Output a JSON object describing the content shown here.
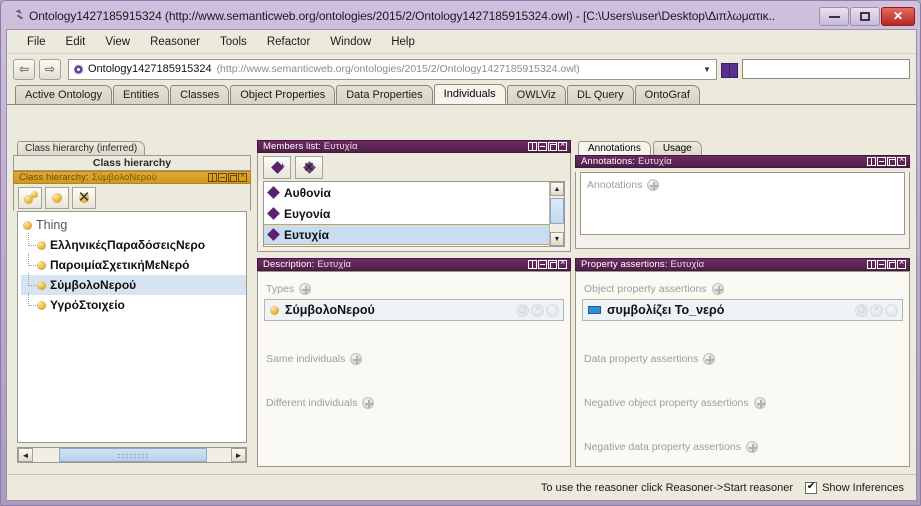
{
  "window": {
    "title": "Ontology1427185915324 (http://www.semanticweb.org/ontologies/2015/2/Ontology1427185915324.owl) - [C:\\Users\\user\\Desktop\\Διπλωματικ..",
    "icon": "protege-icon",
    "buttons": {
      "minimize": "",
      "maximize": "",
      "close": "✕"
    }
  },
  "menubar": {
    "items": [
      "File",
      "Edit",
      "View",
      "Reasoner",
      "Tools",
      "Refactor",
      "Window",
      "Help"
    ]
  },
  "toolbar": {
    "back_label": "⇦",
    "forward_label": "⇨",
    "ontology_name": "Ontology1427185915324",
    "ontology_iri": "(http://www.semanticweb.org/ontologies/2015/2/Ontology1427185915324.owl)",
    "combo_arrow": "▼",
    "search_placeholder": "",
    "search_value": ""
  },
  "tabs": {
    "items": [
      {
        "label": "Active Ontology",
        "active": false
      },
      {
        "label": "Entities",
        "active": false
      },
      {
        "label": "Classes",
        "active": false
      },
      {
        "label": "Object Properties",
        "active": false
      },
      {
        "label": "Data Properties",
        "active": false
      },
      {
        "label": "Individuals",
        "active": true
      },
      {
        "label": "OWLViz",
        "active": false
      },
      {
        "label": "DL Query",
        "active": false
      },
      {
        "label": "OntoGraf",
        "active": false
      }
    ]
  },
  "class_hierarchy_panel": {
    "outer_tab": "Class hierarchy (inferred)",
    "inner_tab": "Class hierarchy",
    "title_prefix": "Class hierarchy:",
    "title_entity": "ΣύμβολοΝερού",
    "tools": [
      "add-subclass",
      "add-sibling-class",
      "delete-class"
    ],
    "tree": [
      {
        "label": "Thing",
        "depth": 0,
        "selected": false
      },
      {
        "label": "ΕλληνικέςΠαραδόσειςΝερο",
        "depth": 1,
        "selected": false
      },
      {
        "label": "ΠαροιμίαΣχετικήΜεΝερό",
        "depth": 1,
        "selected": false
      },
      {
        "label": "ΣύμβολοΝερού",
        "depth": 1,
        "selected": true
      },
      {
        "label": "ΥγρόΣτοιχείο",
        "depth": 1,
        "selected": false
      }
    ],
    "hscroll": {
      "left_arrow": "◄",
      "right_arrow": "►"
    }
  },
  "members_panel": {
    "title_prefix": "Members list:",
    "title_entity": "Ευτυχία",
    "tools": [
      "add-individual",
      "delete-individual"
    ],
    "items": [
      {
        "label": "Αυθονία",
        "selected": false
      },
      {
        "label": "Ευγονία",
        "selected": false
      },
      {
        "label": "Ευτυχία",
        "selected": true
      }
    ],
    "vscroll": {
      "up_arrow": "▲",
      "down_arrow": "▼"
    }
  },
  "annotations_panel": {
    "tabs": [
      {
        "label": "Annotations",
        "active": true
      },
      {
        "label": "Usage",
        "active": false
      }
    ],
    "title_prefix": "Annotations:",
    "title_entity": "Ευτυχία",
    "section_label": "Annotations"
  },
  "description_panel": {
    "title_prefix": "Description:",
    "title_entity": "Ευτυχία",
    "sections": [
      {
        "label": "Types",
        "value": "ΣύμβολοΝερού"
      },
      {
        "label": "Same individuals",
        "value": ""
      },
      {
        "label": "Different individuals",
        "value": ""
      }
    ]
  },
  "property_assertions_panel": {
    "title_prefix": "Property assertions:",
    "title_entity": "Ευτυχία",
    "sections": [
      {
        "label": "Object property assertions",
        "value": "συμβολίζει  Το_νερό"
      },
      {
        "label": "Data property assertions",
        "value": ""
      },
      {
        "label": "Negative object property assertions",
        "value": ""
      },
      {
        "label": "Negative data property assertions",
        "value": ""
      }
    ]
  },
  "statusbar": {
    "text": "To use the reasoner click Reasoner->Start reasoner",
    "checkbox_label": "Show Inferences",
    "checkbox_checked": true
  },
  "colors": {
    "panel_title": "#5a2253",
    "panel_title_active": "#d9a22b",
    "window_chrome": "#bfaed0",
    "app_bg": "#ece9dd",
    "selection": "#c9ddf0",
    "class_icon": "#e0a62c",
    "individual_icon": "#5b2070",
    "object_property_icon": "#2f8fd6"
  }
}
